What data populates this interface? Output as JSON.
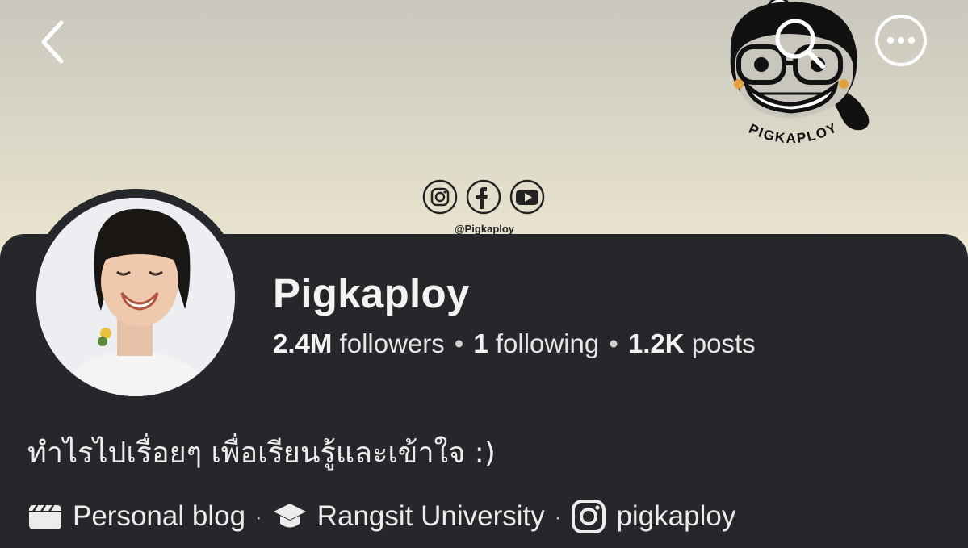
{
  "cover": {
    "mascot_label": "PIGKAPLOY",
    "social_handle": "@Pigkaploy",
    "social_icons": [
      "instagram-icon",
      "facebook-icon",
      "youtube-icon"
    ]
  },
  "header": {
    "back_icon": "chevron-left-icon",
    "search_icon": "search-icon",
    "more_icon": "more-options-icon"
  },
  "profile": {
    "name": "Pigkaploy",
    "followers_count": "2.4M",
    "followers_label": "followers",
    "following_count": "1",
    "following_label": "following",
    "posts_count": "1.2K",
    "posts_label": "posts",
    "separator": "•",
    "bio": "ทำไรไปเรื่อยๆ เพื่อเรียนรู้และเข้าใจ :)"
  },
  "info": {
    "category": "Personal blog",
    "education": "Rangsit University",
    "instagram": "pigkaploy",
    "separator": "·"
  },
  "colors": {
    "panel_bg": "#25272a",
    "cover_top": "#c9c7bd",
    "cover_bottom": "#ebe6cf",
    "text": "#e8e8e8"
  }
}
